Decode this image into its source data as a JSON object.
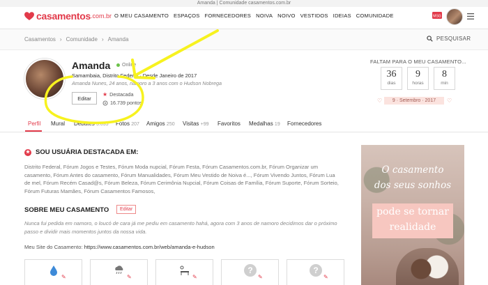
{
  "page_title": "Amanda | Comunidade casamentos.com.br",
  "logo": {
    "brand": "casamentos",
    "tld": ".com.br"
  },
  "nav": [
    "O MEU CASAMENTO",
    "ESPAÇOS",
    "FORNECEDORES",
    "NOIVA",
    "NOIVO",
    "VESTIDOS",
    "IDEIAS",
    "COMUNIDADE"
  ],
  "header": {
    "msg_badge": "MSG"
  },
  "breadcrumb": [
    "Casamentos",
    "Comunidade",
    "Amanda"
  ],
  "breadcrumb_sep": "›",
  "search": {
    "label": "PESQUISAR"
  },
  "profile": {
    "name": "Amanda",
    "status": "Online",
    "location": "Samambaia, Distrito Federal · Desde Janeiro de 2017",
    "bio": "Amanda Nunes, 24 anos, namoro a 3 anos com o Hudson Nobrega",
    "edit_label": "Editar",
    "featured_label": "Destacada",
    "points": "16.739 pontos"
  },
  "countdown": {
    "label": "FALTAM PARA O MEU CASAMENTO...",
    "items": [
      {
        "num": "36",
        "unit": "dias"
      },
      {
        "num": "9",
        "unit": "horas"
      },
      {
        "num": "8",
        "unit": "min"
      }
    ],
    "date": "9 · Setembro · 2017",
    "ornament_left": "♡",
    "ornament_right": "♡"
  },
  "tabs": [
    {
      "label": "Perfil",
      "count": ""
    },
    {
      "label": "Mural",
      "count": ""
    },
    {
      "label": "Debates",
      "count": "3.035"
    },
    {
      "label": "Fotos",
      "count": "207"
    },
    {
      "label": "Amigos",
      "count": "250"
    },
    {
      "label": "Visitas",
      "count": "+99"
    },
    {
      "label": "Favoritos",
      "count": ""
    },
    {
      "label": "Medalhas",
      "count": "19"
    },
    {
      "label": "Fornecedores",
      "count": ""
    }
  ],
  "featured_section": {
    "title": "SOU USUÁRIA DESTACADA EM:",
    "badge": "★",
    "forums": "Distrito Federal, Fórum Jogos e Testes, Fórum Moda nupcial, Fórum Festa, Fórum Casamentos.com.br, Fórum Organizar um casamento, Fórum Antes do casamento, Fórum Manualidades, Fórum Meu Vestido de Noiva é..., Fórum Vivendo Juntos, Fórum Lua de mel, Fórum Recém Casad@s, Fórum Beleza, Fórum Cerimônia Nupcial, Fórum Coisas de Família, Fórum Suporte, Fórum Sorteio, Fórum Futuras Mamães, Fórum Casamentos Famosos,"
  },
  "about_section": {
    "title": "SOBRE MEU CASAMENTO",
    "edit_label": "Editar",
    "story": "Nunca fui pedida em namoro, o loucó de cara já me pediu em casamento hahá, agora com 3 anos de namoro decidimos dar o próximo passo e dividir mais momentos juntos da nossa vida.",
    "site_label": "Meu Site do Casamento:",
    "site_url": "https://www.casamentos.com.br/web/amanda-e-hudson"
  },
  "cards": [
    {
      "icon": "water-drop-icon"
    },
    {
      "icon": "cloud-rain-icon"
    },
    {
      "icon": "sun-bench-icon"
    },
    {
      "icon": "question-icon",
      "mark": "?"
    },
    {
      "icon": "question-icon",
      "mark": "?"
    }
  ],
  "ad": {
    "line1": "O casamento",
    "line2": "dos seus sonhos",
    "line3": "pode se tornar",
    "line4": "realidade"
  },
  "colors": {
    "accent": "#e23a4a",
    "annotation": "#f7f21f",
    "online": "#6cc24a"
  }
}
